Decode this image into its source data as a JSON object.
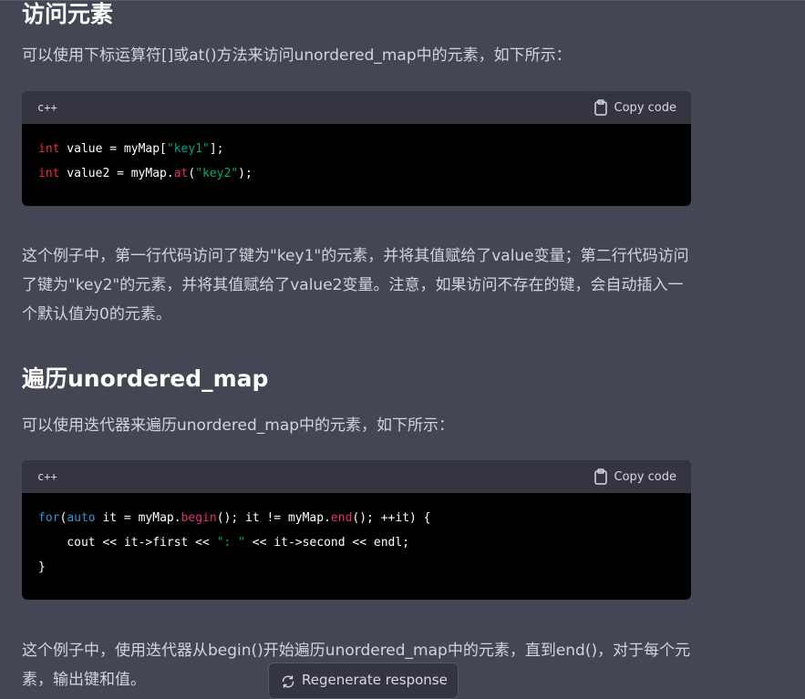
{
  "sections": [
    {
      "heading": "访问元素",
      "intro": "可以使用下标运算符[]或at()方法来访问unordered_map中的元素，如下所示：",
      "code": {
        "language": "c++",
        "copy_label": "Copy code",
        "lines": [
          [
            {
              "t": "int",
              "c": "kw"
            },
            {
              "t": " value = myMap["
            },
            {
              "t": "\"key1\"",
              "c": "str"
            },
            {
              "t": "];"
            }
          ],
          [
            {
              "t": "int",
              "c": "kw"
            },
            {
              "t": " value2 = myMap."
            },
            {
              "t": "at",
              "c": "fn"
            },
            {
              "t": "("
            },
            {
              "t": "\"key2\"",
              "c": "str"
            },
            {
              "t": ");"
            }
          ]
        ]
      },
      "explanation": "这个例子中，第一行代码访问了键为\"key1\"的元素，并将其值赋给了value变量；第二行代码访问了键为\"key2\"的元素，并将其值赋给了value2变量。注意，如果访问不存在的键，会自动插入一个默认值为0的元素。"
    },
    {
      "heading": "遍历unordered_map",
      "intro": "可以使用迭代器来遍历unordered_map中的元素，如下所示：",
      "code": {
        "language": "c++",
        "copy_label": "Copy code",
        "lines": [
          [
            {
              "t": "for",
              "c": "kw2"
            },
            {
              "t": "("
            },
            {
              "t": "auto",
              "c": "kw2"
            },
            {
              "t": " it = myMap."
            },
            {
              "t": "begin",
              "c": "fn"
            },
            {
              "t": "(); it != myMap."
            },
            {
              "t": "end",
              "c": "fn"
            },
            {
              "t": "(); ++it) {"
            }
          ],
          [
            {
              "t": "    cout << it->first << "
            },
            {
              "t": "\": \"",
              "c": "str"
            },
            {
              "t": " << it->second << endl;"
            }
          ],
          [
            {
              "t": "}"
            }
          ]
        ]
      },
      "explanation": "这个例子中，使用迭代器从begin()开始遍历unordered_map中的元素，直到end()，对于每个元素，输出键和值。"
    }
  ],
  "regenerate_button": {
    "label": "Regenerate response",
    "icon": "refresh-icon"
  },
  "colors": {
    "background": "#444654",
    "code_bg": "#000000",
    "code_header": "#343541",
    "keyword": "#f22c3d",
    "keyword_blue": "#2e95d3",
    "string": "#00a67d",
    "function": "#df3079"
  }
}
